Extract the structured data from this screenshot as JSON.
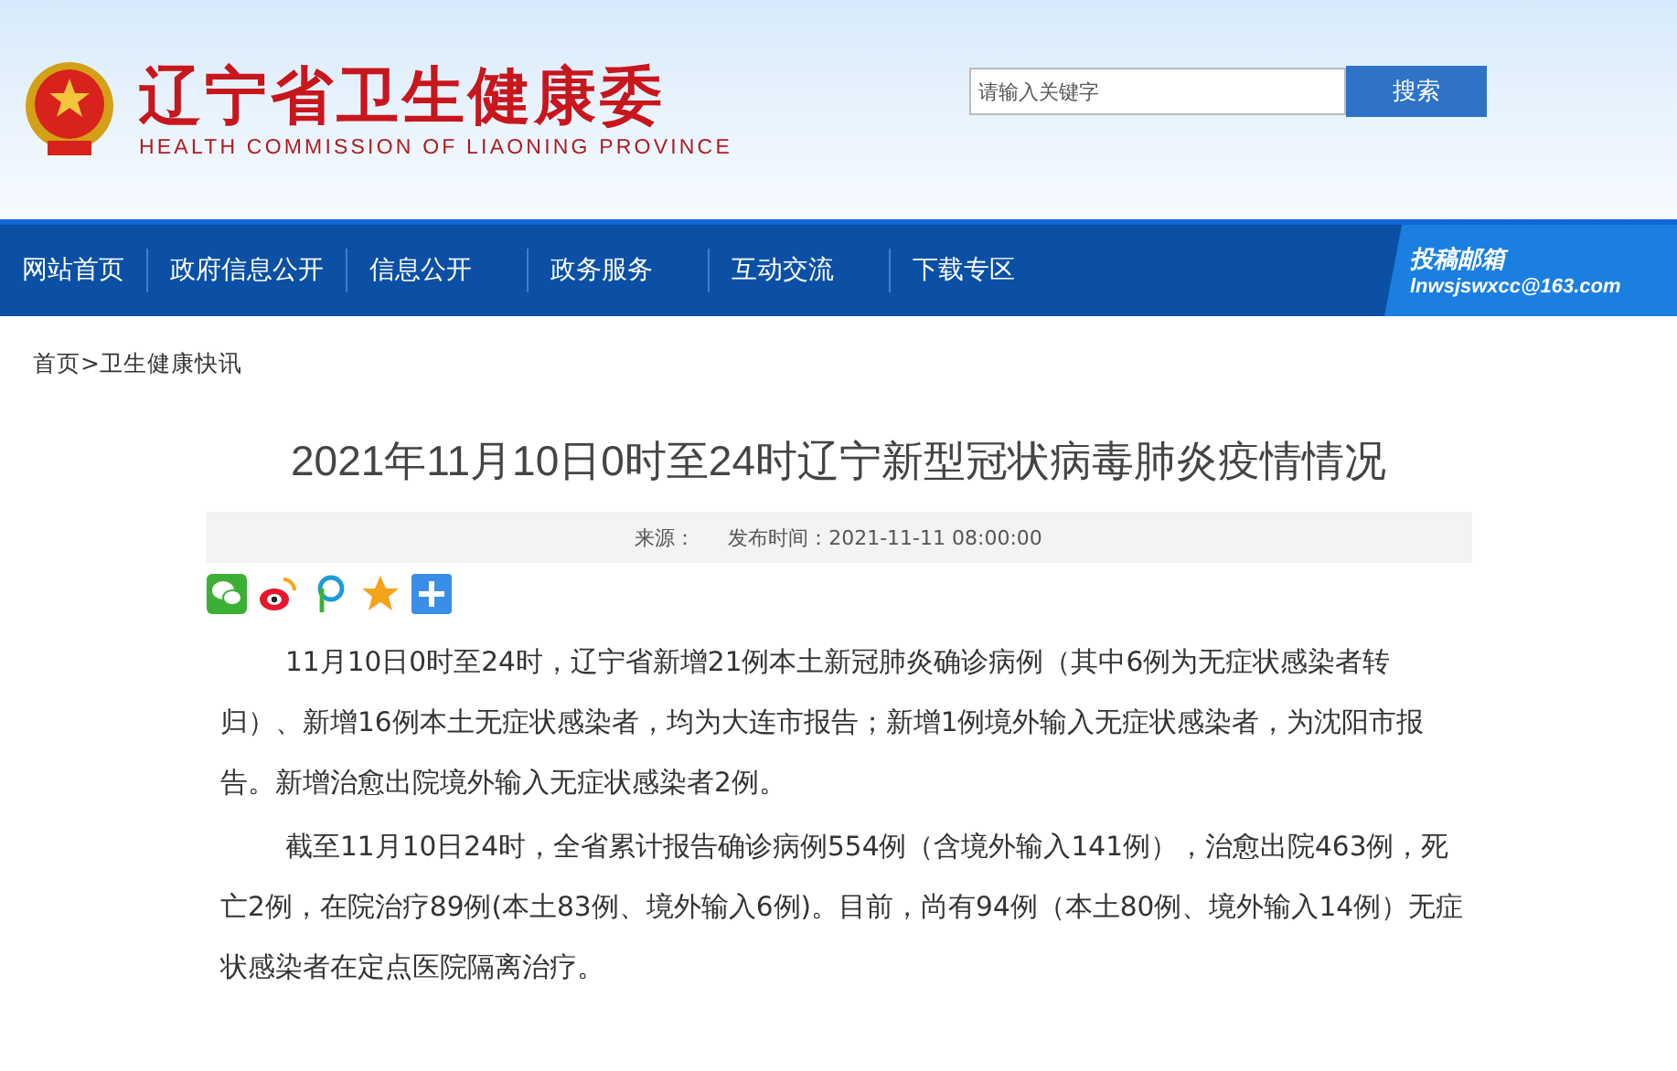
{
  "header": {
    "title": "辽宁省卫生健康委",
    "subtitle": "HEALTH COMMISSION OF LIAONING PROVINCE",
    "search": {
      "placeholder": "请输入关键字",
      "button": "搜索"
    }
  },
  "nav": {
    "items": [
      {
        "label": "网站首页"
      },
      {
        "label": "政府信息公开"
      },
      {
        "label": "信息公开"
      },
      {
        "label": "政务服务"
      },
      {
        "label": "互动交流"
      },
      {
        "label": "下载专区"
      }
    ],
    "mailbox": {
      "title": "投稿邮箱",
      "email": "lnwsjswxcc@163.com"
    }
  },
  "breadcrumb": [
    {
      "label": "首页"
    },
    {
      "label": ">"
    },
    {
      "label": "卫生健康快讯"
    }
  ],
  "article": {
    "title": "2021年11月10日0时至24时辽宁新型冠状病毒肺炎疫情情况",
    "meta": [
      {
        "label": "来源："
      },
      {
        "label": "发布时间：2021-11-11 08:00:00"
      }
    ],
    "share": [
      {
        "kind": "wechat"
      },
      {
        "kind": "weibo"
      },
      {
        "kind": "pin"
      },
      {
        "kind": "star"
      },
      {
        "kind": "plus"
      }
    ],
    "paragraphs": [
      "11月10日0时至24时，辽宁省新增21例本土新冠肺炎确诊病例（其中6例为无症状感染者转归）、新增16例本土无症状感染者，均为大连市报告；新增1例境外输入无症状感染者，为沈阳市报告。新增治愈出院境外输入无症状感染者2例。",
      "截至11月10日24时，全省累计报告确诊病例554例（含境外输入141例），治愈出院463例，死亡2例，在院治疗89例(本土83例、境外输入6例)。目前，尚有94例（本土80例、境外输入14例）无症状感染者在定点医院隔离治疗。"
    ]
  }
}
